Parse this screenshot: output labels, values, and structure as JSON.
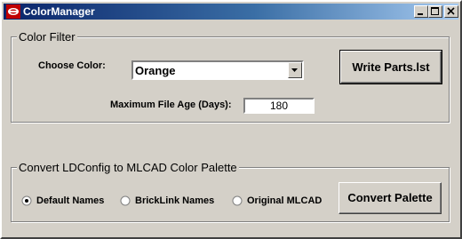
{
  "window": {
    "title": "ColorManager",
    "colors": {
      "titlebar_start": "#0a246a",
      "titlebar_end": "#a6caf0",
      "face": "#d4d0c8",
      "app_icon": "#c00000"
    },
    "icons": {
      "app": "app-icon",
      "minimize": "minimize-icon",
      "maximize": "maximize-icon",
      "close": "close-icon"
    }
  },
  "color_filter": {
    "legend": "Color Filter",
    "choose_color_label": "Choose Color:",
    "color_value": "Orange",
    "max_age_label": "Maximum File Age (Days):",
    "max_age_value": "180",
    "write_button": "Write Parts.lst"
  },
  "convert": {
    "legend": "Convert LDConfig to MLCAD Color Palette",
    "options": [
      {
        "label": "Default Names",
        "selected": true
      },
      {
        "label": "BrickLink Names",
        "selected": false
      },
      {
        "label": "Original MLCAD",
        "selected": false
      }
    ],
    "convert_button": "Convert Palette"
  }
}
